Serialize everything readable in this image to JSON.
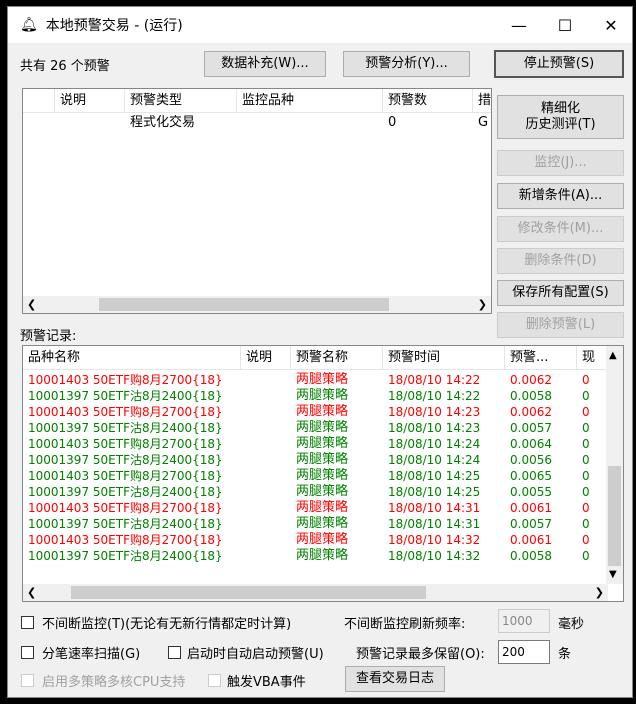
{
  "window": {
    "title": "本地预警交易 - (运行)",
    "minimize": "—",
    "maximize": "☐",
    "close": "✕"
  },
  "summary": "共有 26 个预警",
  "buttons": {
    "data_supplement": "数据补充(W)...",
    "alert_analysis": "预警分析(Y)...",
    "stop_alert": "停止预警(S)",
    "history_test_1": "精细化",
    "history_test_2": "历史测评(T)",
    "monitor": "监控(J)...",
    "add_condition": "新增条件(A)...",
    "modify_condition": "修改条件(M)...",
    "delete_condition": "删除条件(D)",
    "save_all": "保存所有配置(S)",
    "delete_alert": "删除预警(L)",
    "view_log": "查看交易日志"
  },
  "alert_table": {
    "columns": [
      "",
      "说明",
      "预警类型",
      "监控品种",
      "预警数",
      "措"
    ],
    "rows": [
      [
        "",
        "",
        "程式化交易",
        "",
        "0",
        "G"
      ]
    ]
  },
  "records_label": "预警记录:",
  "records": {
    "columns": [
      "品种名称",
      "说明",
      "预警名称",
      "预警时间",
      "预警...",
      "现"
    ],
    "colors": {
      "red": "#ff0000",
      "green": "#008000"
    },
    "rows": [
      {
        "name": "10001403 50ETF购8月2700{18}",
        "note": "",
        "alert": "两腿策略",
        "time": "18/08/10 14:22",
        "value": "0.0062",
        "last": "0",
        "color": "red"
      },
      {
        "name": "10001397 50ETF沽8月2400{18}",
        "note": "",
        "alert": "两腿策略",
        "time": "18/08/10 14:22",
        "value": "0.0058",
        "last": "0",
        "color": "green"
      },
      {
        "name": "10001403 50ETF购8月2700{18}",
        "note": "",
        "alert": "两腿策略",
        "time": "18/08/10 14:23",
        "value": "0.0062",
        "last": "0",
        "color": "red"
      },
      {
        "name": "10001397 50ETF沽8月2400{18}",
        "note": "",
        "alert": "两腿策略",
        "time": "18/08/10 14:23",
        "value": "0.0057",
        "last": "0",
        "color": "green"
      },
      {
        "name": "10001403 50ETF购8月2700{18}",
        "note": "",
        "alert": "两腿策略",
        "time": "18/08/10 14:24",
        "value": "0.0064",
        "last": "0",
        "color": "green"
      },
      {
        "name": "10001397 50ETF沽8月2400{18}",
        "note": "",
        "alert": "两腿策略",
        "time": "18/08/10 14:24",
        "value": "0.0056",
        "last": "0",
        "color": "green"
      },
      {
        "name": "10001403 50ETF购8月2700{18}",
        "note": "",
        "alert": "两腿策略",
        "time": "18/08/10 14:25",
        "value": "0.0065",
        "last": "0",
        "color": "green"
      },
      {
        "name": "10001397 50ETF沽8月2400{18}",
        "note": "",
        "alert": "两腿策略",
        "time": "18/08/10 14:25",
        "value": "0.0055",
        "last": "0",
        "color": "green"
      },
      {
        "name": "10001403 50ETF购8月2700{18}",
        "note": "",
        "alert": "两腿策略",
        "time": "18/08/10 14:31",
        "value": "0.0061",
        "last": "0",
        "color": "red"
      },
      {
        "name": "10001397 50ETF沽8月2400{18}",
        "note": "",
        "alert": "两腿策略",
        "time": "18/08/10 14:31",
        "value": "0.0057",
        "last": "0",
        "color": "green"
      },
      {
        "name": "10001403 50ETF购8月2700{18}",
        "note": "",
        "alert": "两腿策略",
        "time": "18/08/10 14:32",
        "value": "0.0061",
        "last": "0",
        "color": "red"
      },
      {
        "name": "10001397 50ETF沽8月2400{18}",
        "note": "",
        "alert": "两腿策略",
        "time": "18/08/10 14:32",
        "value": "0.0058",
        "last": "0",
        "color": "green"
      }
    ]
  },
  "options": {
    "continuous_monitor": "不间断监控(T)(无论有无新行情都定时计算)",
    "refresh_label": "不间断监控刷新频率:",
    "refresh_value": "1000",
    "refresh_unit": "毫秒",
    "tick_scan": "分笔速率扫描(G)",
    "auto_start": "启动时自动启动预警(U)",
    "max_records_label": "预警记录最多保留(O):",
    "max_records_value": "200",
    "max_records_unit": "条",
    "multicore": "启用多策略多核CPU支持",
    "vba": "触发VBA事件"
  }
}
